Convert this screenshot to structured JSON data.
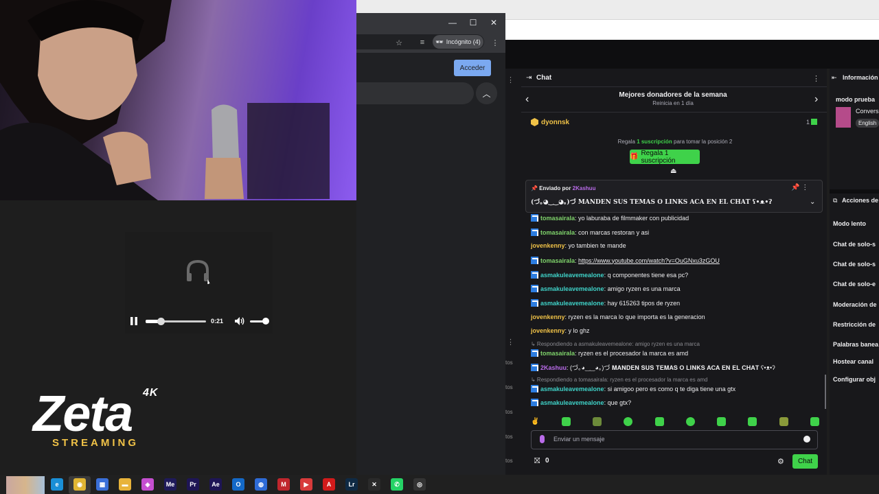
{
  "browser": {
    "incognito_label": "Incógnito (4)",
    "acceder": "Acceder",
    "window_buttons": {
      "minimize": "—",
      "maximize": "☐",
      "close": "✕"
    }
  },
  "player": {
    "time": "0:21",
    "progress": 0.25,
    "volume": 0.7
  },
  "logo": {
    "four_k": "4K",
    "brand": "Zeta",
    "sub": "STREAMING"
  },
  "left_strip": [
    "tos",
    "tos",
    "tos",
    "tos",
    "tos"
  ],
  "chat": {
    "title": "Chat",
    "donors_title": "Mejores donadores de la semana",
    "donors_sub": "Reinicia en 1 día",
    "top_donor": "dyonnsk",
    "top_donor_count": "1",
    "gift_prefix": "Regala",
    "gift_highlight": "1 suscripción",
    "gift_suffix": "para tomar la posición 2",
    "gift_button": "Regala 1 suscripción",
    "pinned_by_label": "Enviado por",
    "pinned_by_user": "2Kashuu",
    "pinned_message": "(づ｡◕‿‿◕｡)づ 𝐌𝐀𝐍𝐃𝐄𝐍 𝐒𝐔𝐒 𝐓𝐄𝐌𝐀𝐒 𝐎 𝐋𝐈𝐍𝐊𝐒 𝐀𝐂𝐀 𝐄𝐍 𝐄𝐋 𝐂𝐇𝐀𝐓 ʕ•ᴥ•ʔ",
    "messages": [
      {
        "user": "tomasairala",
        "color": "#7fd36b",
        "badge": true,
        "text": ": yo laburaba de filmmaker con publicidad"
      },
      {
        "user": "tomasairala",
        "color": "#7fd36b",
        "badge": true,
        "text": ": con marcas restoran y asi"
      },
      {
        "user": "jovenkenny",
        "color": "#f0c247",
        "badge": false,
        "text": ": yo tambien te mande"
      },
      {
        "user": "tomasairala",
        "color": "#7fd36b",
        "badge": true,
        "text": ": ",
        "link": "https://www.youtube.com/watch?v=OuGNxu3zGOU"
      },
      {
        "user": "asmakuleavemealone",
        "color": "#3fd2c8",
        "badge": true,
        "text": ": q componentes tiene esa pc?"
      },
      {
        "user": "asmakuleavemealone",
        "color": "#3fd2c8",
        "badge": true,
        "text": ": amigo ryzen es una marca"
      },
      {
        "user": "asmakuleavemealone",
        "color": "#3fd2c8",
        "badge": true,
        "text": ": hay 615263 tipos de ryzen"
      },
      {
        "user": "jovenkenny",
        "color": "#f0c247",
        "badge": false,
        "text": ": ryzen es la marca lo que importa es la generacion"
      },
      {
        "user": "jovenkenny",
        "color": "#f0c247",
        "badge": false,
        "text": ": y lo ghz"
      },
      {
        "reply": "Respondiendo a asmakuleavemealone: amigo ryzen es una marca"
      },
      {
        "user": "tomasairala",
        "color": "#7fd36b",
        "badge": true,
        "text": ": ryzen es el procesador la marca es amd"
      },
      {
        "user": "2Kashuu",
        "color": "#b96be9",
        "badge": true,
        "text": ": (づ｡◕‿‿◕｡)づ 𝐌𝐀𝐍𝐃𝐄𝐍 𝐒𝐔𝐒 𝐓𝐄𝐌𝐀𝐒 𝐎 𝐋𝐈𝐍𝐊𝐒 𝐀𝐂𝐀 𝐄𝐍 𝐄𝐋 𝐂𝐇𝐀𝐓 ʕ•ᴥ•ʔ"
      },
      {
        "reply": "Respondiendo a tomasairala: ryzen es el procesador la marca es amd"
      },
      {
        "user": "asmakuleavemealone",
        "color": "#3fd2c8",
        "badge": true,
        "text": ": si amigoo pero es como q te diga tiene una gtx"
      },
      {
        "user": "asmakuleavemealone",
        "color": "#3fd2c8",
        "badge": true,
        "text": ": que gtx?"
      }
    ],
    "input_placeholder": "Enviar un mensaje",
    "points": "0",
    "chat_button": "Chat"
  },
  "right_panel": {
    "info_title": "Información",
    "modo_prueba": "modo prueba",
    "conv": "Convers",
    "lang": "English",
    "actions_title": "Acciones de",
    "actions": [
      "Modo lento",
      "Chat de solo-s",
      "Chat de solo-s",
      "Chat de solo-e",
      "Moderación de",
      "Restricción de",
      "Palabras banea",
      "Hostear canal",
      "Configurar obj"
    ]
  },
  "taskbar": [
    {
      "name": "edge",
      "label": "e",
      "color": "#1a8fd6"
    },
    {
      "name": "chrome",
      "label": "◉",
      "color": "#e0b533"
    },
    {
      "name": "store",
      "label": "▦",
      "color": "#3a6fd8"
    },
    {
      "name": "explorer",
      "label": "▬",
      "color": "#e8b33a"
    },
    {
      "name": "photos",
      "label": "◈",
      "color": "#c54fd0"
    },
    {
      "name": "media-encoder",
      "label": "Me",
      "color": "#1f1a5a"
    },
    {
      "name": "premiere",
      "label": "Pr",
      "color": "#1e1555"
    },
    {
      "name": "after-effects",
      "label": "Ae",
      "color": "#1e1555"
    },
    {
      "name": "outlook",
      "label": "O",
      "color": "#1469c7"
    },
    {
      "name": "vpn",
      "label": "◍",
      "color": "#2e6bd6"
    },
    {
      "name": "shield",
      "label": "M",
      "color": "#c0262d"
    },
    {
      "name": "anydesk",
      "label": "▶",
      "color": "#d83b3b"
    },
    {
      "name": "acrobat",
      "label": "A",
      "color": "#d21b1b"
    },
    {
      "name": "lightroom",
      "label": "Lr",
      "color": "#0f2a44"
    },
    {
      "name": "capcut",
      "label": "✕",
      "color": "#2a2a2a"
    },
    {
      "name": "whatsapp",
      "label": "✆",
      "color": "#25d366"
    },
    {
      "name": "obs",
      "label": "◎",
      "color": "#333333"
    }
  ]
}
